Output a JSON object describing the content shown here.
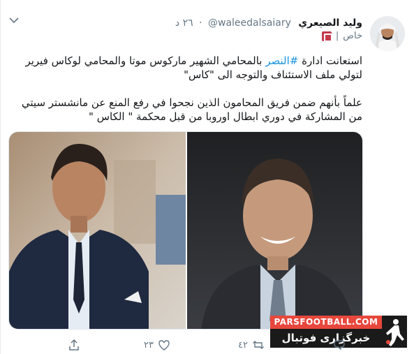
{
  "tweet": {
    "author_name": "وليد الصيعري",
    "handle": "@waleedalsaiary",
    "separator": "·",
    "time": "٢٦ د",
    "private_label": "خاص",
    "private_sep": "|",
    "line1_part1": "استعانت ادارة ",
    "hashtag": "#النصر",
    "line1_part2": " بالمحامي الشهير ماركوس موتا والمحامي لوكاس فيرير",
    "line2": "لتولي ملف الاستئناف والتوجه الى \"كاس\"",
    "line3": "علماً بأنهم ضمن فريق المحامون الذين نجحوا  في رفع المنع عن مانشستر سيتي",
    "line4": "من المشاركة في دوري ابطال اوروبا من قبل محكمة \" الكاس \""
  },
  "watermark": {
    "top": "PARSFOOTBALL.COM",
    "bottom": "خبرگزاری فوتبال ایران"
  },
  "actions": {
    "reply_count": "",
    "retweet_count": "٤٢",
    "like_count": "٢٣",
    "share_count": ""
  },
  "icons": [
    "chevron-down-icon",
    "lock-icon",
    "reply-icon",
    "retweet-icon",
    "like-icon",
    "share-icon"
  ]
}
